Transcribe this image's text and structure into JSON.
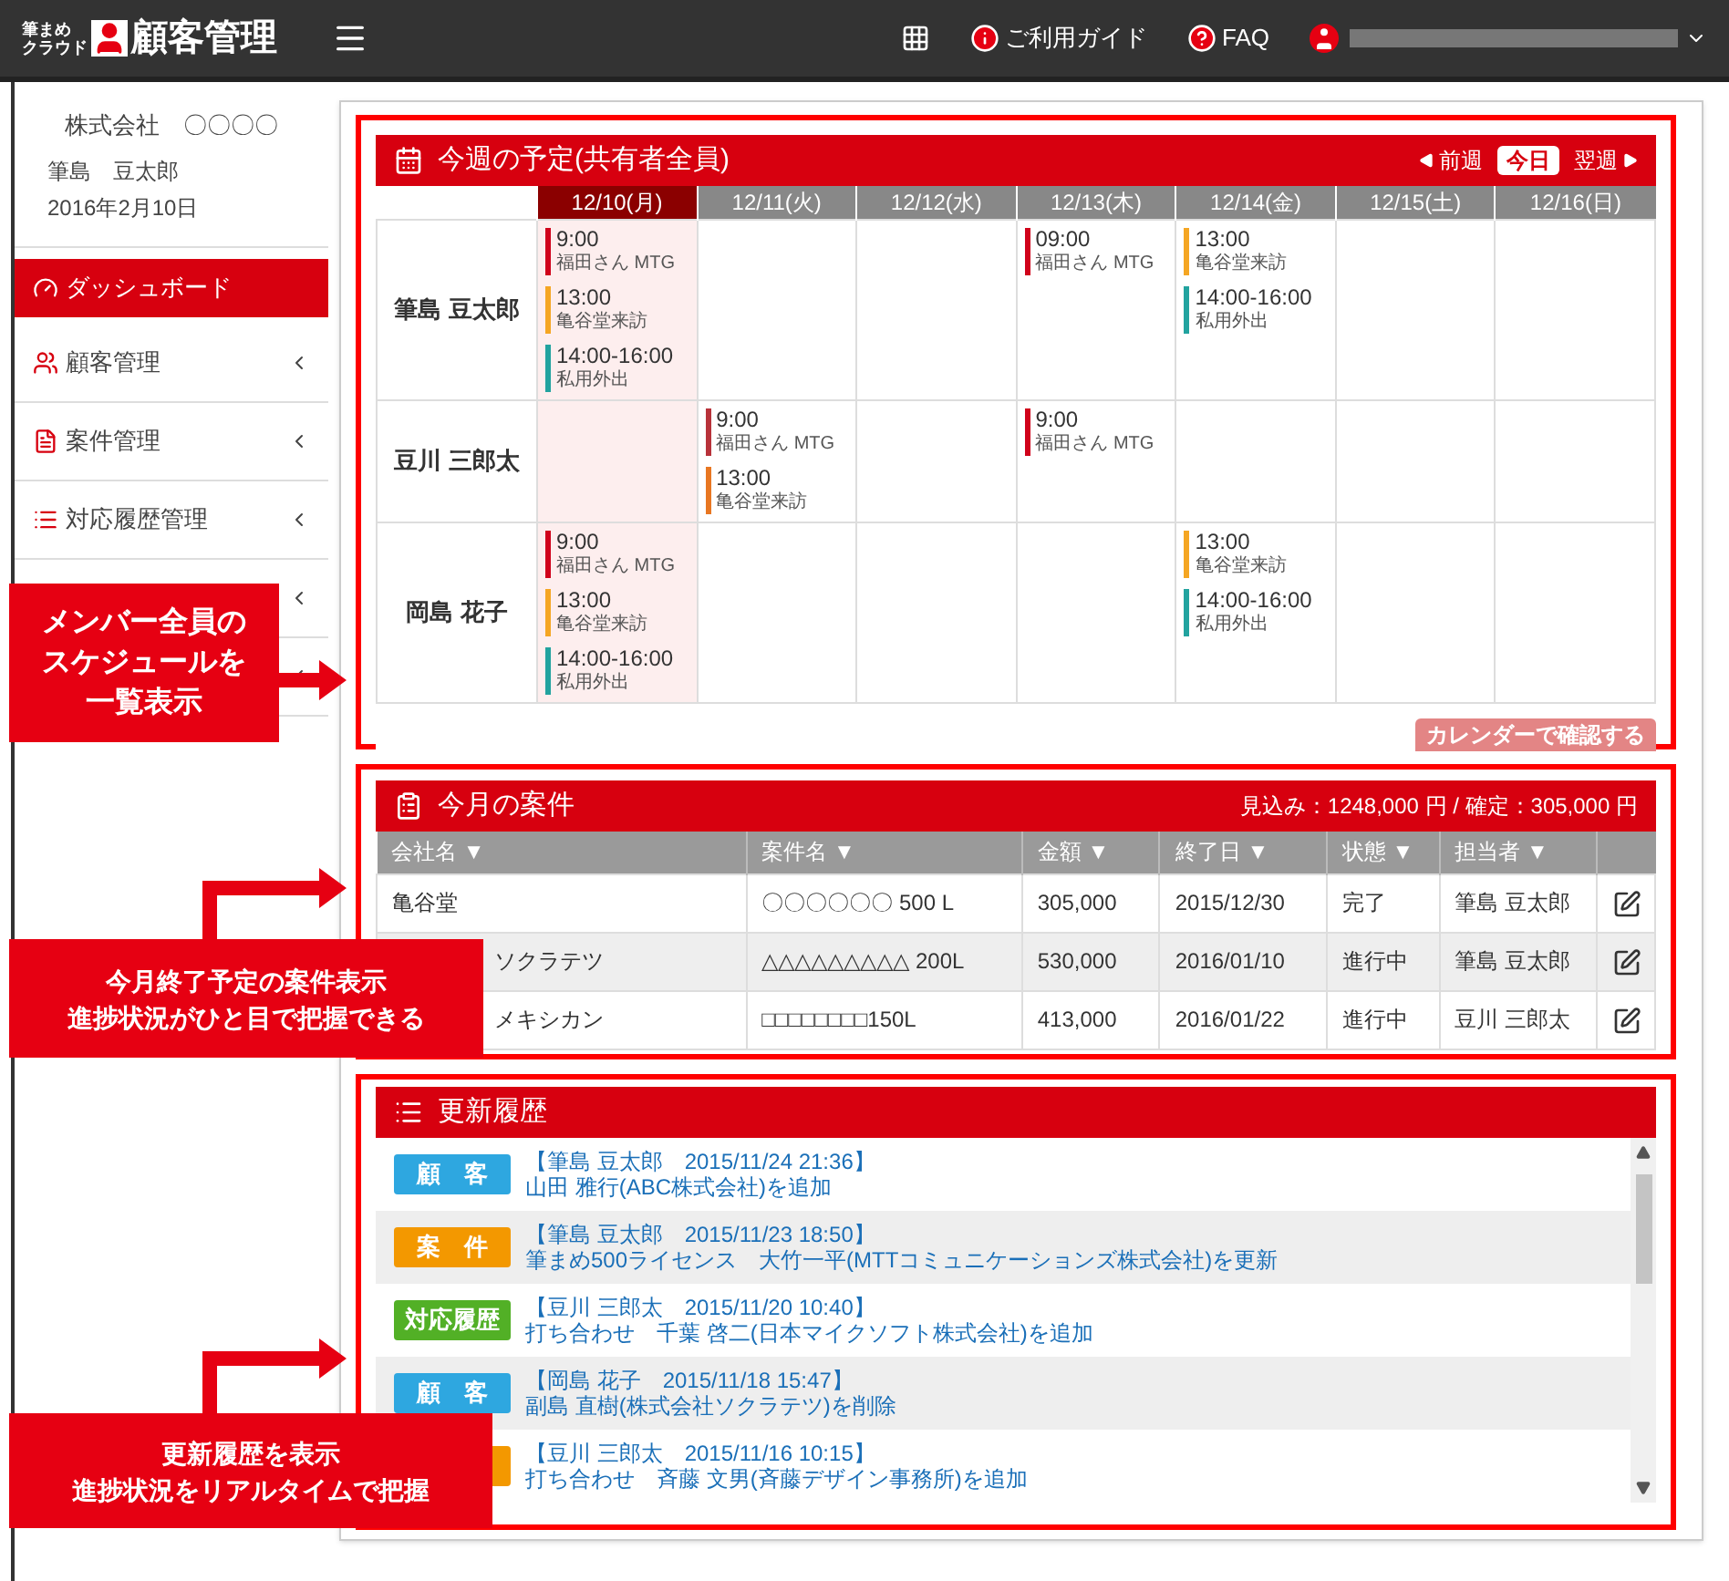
{
  "header": {
    "logo_top": "筆まめ",
    "logo_bottom": "クラウド",
    "app_title": "顧客管理",
    "guide": "ご利用ガイド",
    "faq": "FAQ"
  },
  "sidebar": {
    "company": "株式会社　〇〇〇〇",
    "user": "筆島　豆太郎",
    "date": "2016年2月10日",
    "items": [
      {
        "kind": "dashboard",
        "label": "ダッシュボード",
        "selected": true
      },
      {
        "kind": "customers",
        "label": "顧客管理",
        "selected": false
      },
      {
        "kind": "cases",
        "label": "案件管理",
        "selected": false
      },
      {
        "kind": "history",
        "label": "対応履歴管理",
        "selected": false
      },
      {
        "kind": "admin",
        "selected": false
      },
      {
        "kind": "blank",
        "selected": false
      }
    ]
  },
  "schedule": {
    "title": "今週の予定(共有者全員)",
    "prev": "前週",
    "today": "今日",
    "next": "翌週",
    "button": "カレンダーで確認する",
    "days": [
      {
        "label": "12/10(月)",
        "selected": true
      },
      {
        "label": "12/11(火)",
        "selected": false
      },
      {
        "label": "12/12(水)",
        "selected": false
      },
      {
        "label": "12/13(木)",
        "selected": false
      },
      {
        "label": "12/14(金)",
        "selected": false
      },
      {
        "label": "12/15(土)",
        "selected": false
      },
      {
        "label": "12/16(日)",
        "selected": false
      }
    ],
    "rows": [
      {
        "name": "筆島 豆太郎",
        "cells": [
          [
            {
              "time": "9:00",
              "text": "福田さん MTG",
              "color": "#d0021b"
            },
            {
              "time": "13:00",
              "text": "亀谷堂来訪",
              "color": "#f5a623"
            },
            {
              "time": "14:00-16:00",
              "text": "私用外出",
              "color": "#22a39f"
            }
          ],
          [],
          [],
          [
            {
              "time": "09:00",
              "text": "福田さん MTG",
              "color": "#d0021b"
            }
          ],
          [
            {
              "time": "13:00",
              "text": "亀谷堂来訪",
              "color": "#f5a623"
            },
            {
              "time": "14:00-16:00",
              "text": "私用外出",
              "color": "#22a39f"
            }
          ],
          [],
          []
        ]
      },
      {
        "name": "豆川 三郎太",
        "cells": [
          [],
          [
            {
              "time": "9:00",
              "text": "福田さん MTG",
              "color": "#b8323a"
            },
            {
              "time": "13:00",
              "text": "亀谷堂来訪",
              "color": "#e87722"
            }
          ],
          [],
          [
            {
              "time": "9:00",
              "text": "福田さん MTG",
              "color": "#d0021b"
            }
          ],
          [],
          [],
          []
        ]
      },
      {
        "name": "岡島 花子",
        "cells": [
          [
            {
              "time": "9:00",
              "text": "福田さん MTG",
              "color": "#d0021b"
            },
            {
              "time": "13:00",
              "text": "亀谷堂来訪",
              "color": "#f5a623"
            },
            {
              "time": "14:00-16:00",
              "text": "私用外出",
              "color": "#22a39f"
            }
          ],
          [],
          [],
          [],
          [
            {
              "time": "13:00",
              "text": "亀谷堂来訪",
              "color": "#f5a623"
            },
            {
              "time": "14:00-16:00",
              "text": "私用外出",
              "color": "#22a39f"
            }
          ],
          [],
          []
        ]
      }
    ]
  },
  "cases": {
    "title": "今月の案件",
    "summary": "見込み：1248,000 円 / 確定：305,000 円",
    "columns": [
      "会社名 ▼",
      "案件名 ▼",
      "金額 ▼",
      "終了日 ▼",
      "状態 ▼",
      "担当者 ▼"
    ],
    "rows": [
      {
        "covered": false,
        "cells": [
          "亀谷堂",
          "〇〇〇〇〇〇 500 L",
          "305,000",
          "2015/12/30",
          "完了",
          "筆島 豆太郎"
        ]
      },
      {
        "covered": true,
        "cells": [
          "ソクラテツ",
          "△△△△△△△△△ 200L",
          "530,000",
          "2016/01/10",
          "進行中",
          "筆島 豆太郎"
        ]
      },
      {
        "covered": true,
        "cells": [
          "メキシカン",
          "□□□□□□□□150L",
          "413,000",
          "2016/01/22",
          "進行中",
          "豆川 三郎太"
        ]
      }
    ]
  },
  "history": {
    "title": "更新履歴",
    "items": [
      {
        "kind": "customer",
        "badge": "顧　客",
        "title": "【筆島 豆太郎　2015/11/24 21:36】",
        "text": "山田 雅行(ABC株式会社)を追加"
      },
      {
        "kind": "case",
        "badge": "案　件",
        "title": "【筆島 豆太郎　2015/11/23 18:50】",
        "text": "筆まめ500ライセンス　大竹一平(MTTコミュニケーションズ株式会社)を更新"
      },
      {
        "kind": "response",
        "badge": "対応履歴",
        "title": "【豆川 三郎太　2015/11/20 10:40】",
        "text": "打ち合わせ　千葉 啓二(日本マイクソフト株式会社)を追加"
      },
      {
        "kind": "customer",
        "badge": "顧　客",
        "title": "【岡島 花子　2015/11/18 15:47】",
        "text": "副島 直樹(株式会社ソクラテツ)を削除"
      },
      {
        "kind": "case",
        "title": "【豆川 三郎太　2015/11/16 10:15】",
        "text": "打ち合わせ　斉藤 文男(斉藤デザイン事務所)を追加"
      }
    ]
  },
  "callouts": [
    {
      "lines": [
        "メンバー全員の",
        "スケジュールを",
        "一覧表示"
      ]
    },
    {
      "lines": [
        "今月終了予定の案件表示",
        "進捗状況がひと目で把握できる"
      ]
    },
    {
      "lines": [
        "更新履歴を表示",
        "進捗状況をリアルタイムで把握"
      ]
    }
  ]
}
